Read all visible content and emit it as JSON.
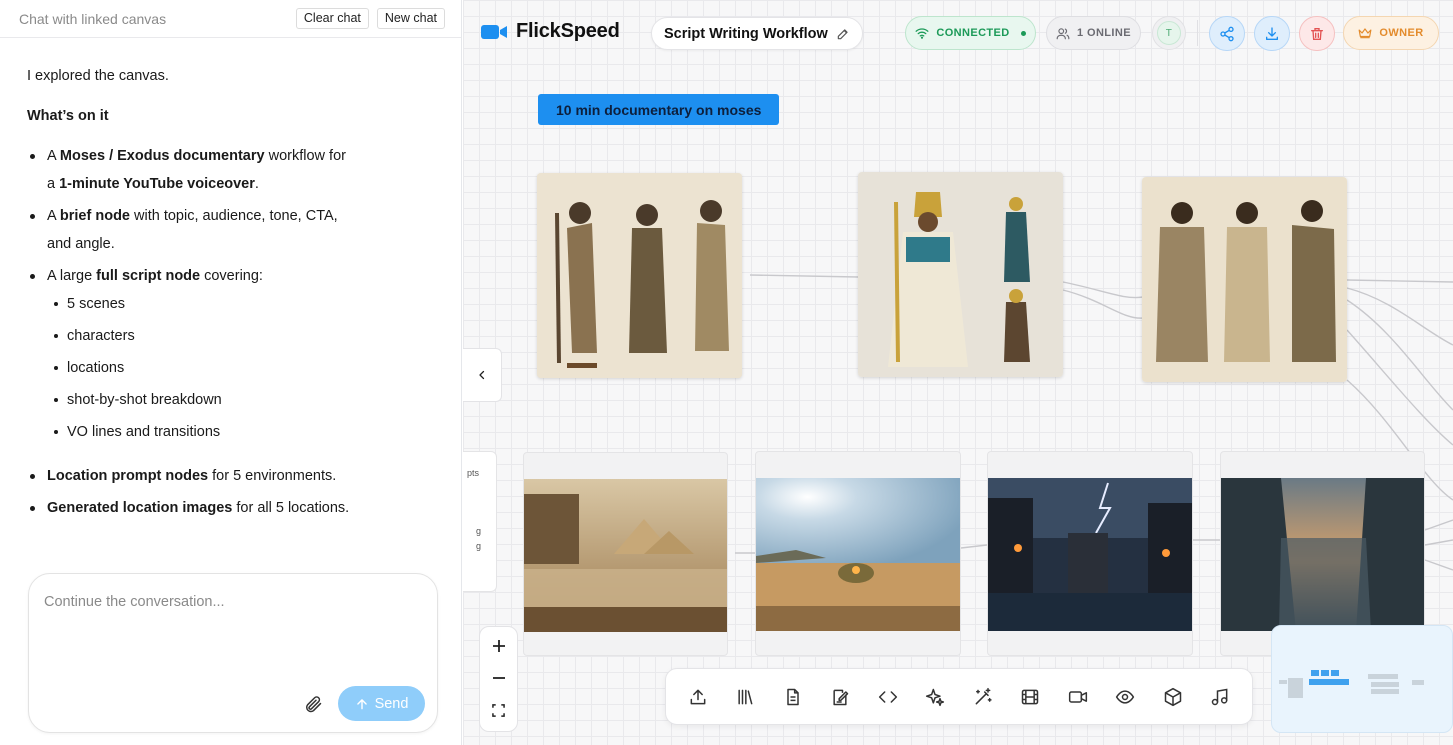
{
  "chat": {
    "title": "Chat with linked canvas",
    "clear_label": "Clear chat",
    "new_label": "New chat",
    "intro": "I explored the canvas.",
    "heading": "What’s on it",
    "bullets": {
      "b1": {
        "pre": "A ",
        "bold1": "Moses / Exodus documentary",
        "mid": " workflow for a ",
        "bold2": "1-minute YouTube voiceover",
        "post": "."
      },
      "b2": {
        "pre": "A ",
        "bold": "brief node",
        "post": " with topic, audience, tone, CTA, and angle."
      },
      "b3": {
        "pre": "A large ",
        "bold": "full script node",
        "post": " covering:"
      },
      "b3_sub": [
        "5 scenes",
        "characters",
        "locations",
        "shot-by-shot breakdown",
        "VO lines and transitions"
      ],
      "b4": {
        "bold": "Location prompt nodes",
        "post": " for 5 environments."
      },
      "b5": {
        "bold": "Generated location images",
        "post": " for all 5 locations."
      }
    },
    "composer_placeholder": "Continue the conversation...",
    "send_label": "Send"
  },
  "canvas": {
    "brand": "FlickSpeed",
    "workflow_title": "Script Writing Workflow",
    "status_connected": "CONNECTED",
    "status_online": "1 ONLINE",
    "avatar_initial": "T",
    "owner_label": "OWNER",
    "prompt_chip": "10 min documentary on moses",
    "ghost_node_text": [
      "pts",
      "g",
      "g"
    ],
    "colors": {
      "accent": "#1d8ff0",
      "connected": "#1c9a58",
      "danger": "#e35353",
      "owner": "#e38b2c"
    },
    "toolbar_icons": [
      "upload-icon",
      "library-icon",
      "document-icon",
      "note-icon",
      "code-icon",
      "sparkles-icon",
      "magic-wand-icon",
      "film-icon",
      "video-camera-icon",
      "eye-icon",
      "cube-icon",
      "music-icon"
    ]
  }
}
